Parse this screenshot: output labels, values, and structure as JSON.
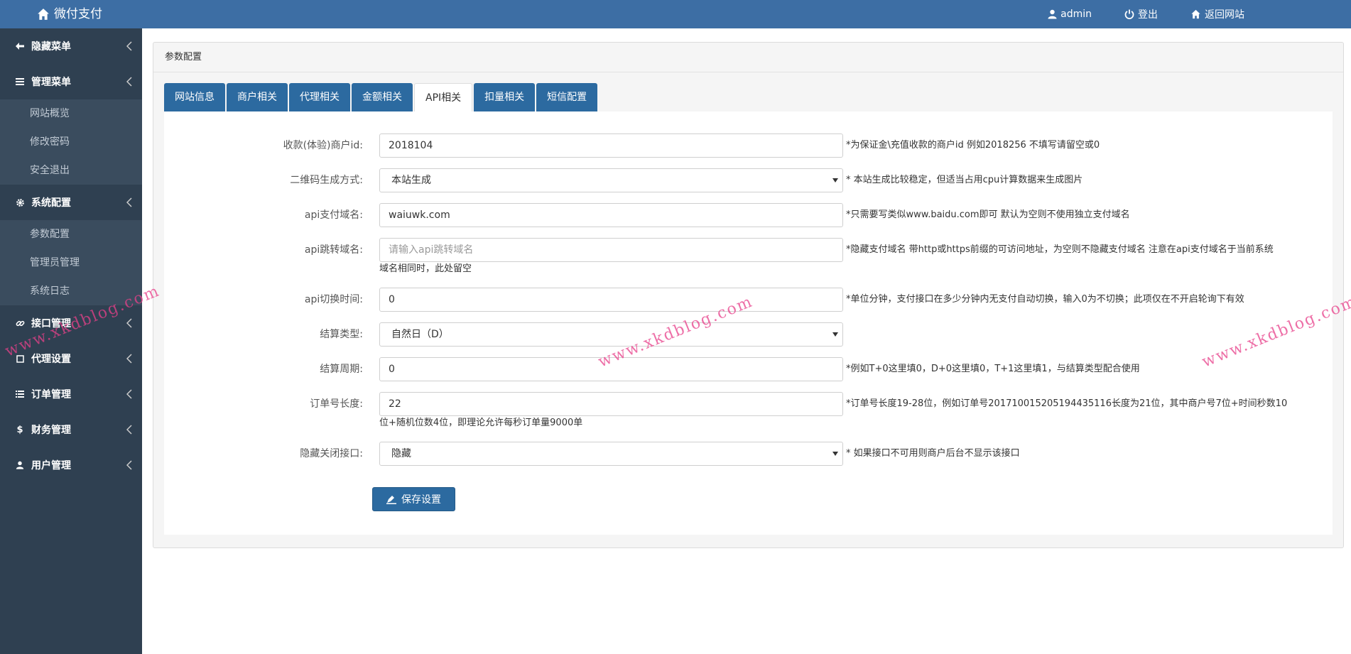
{
  "header": {
    "brand": "微付支付",
    "nav": [
      {
        "label": "admin",
        "icon": "user-icon"
      },
      {
        "label": "登出",
        "icon": "power-icon"
      },
      {
        "label": "返回网站",
        "icon": "home-icon"
      }
    ]
  },
  "sidebar": {
    "groups": [
      {
        "label": "隐藏菜单",
        "icon": "arrow-left-icon"
      },
      {
        "label": "管理菜单",
        "icon": "list-icon",
        "items": [
          "网站概览",
          "修改密码",
          "安全退出"
        ]
      },
      {
        "label": "系统配置",
        "icon": "gear-icon",
        "items": [
          "参数配置",
          "管理员管理",
          "系统日志"
        ]
      },
      {
        "label": "接口管理",
        "icon": "link-icon"
      },
      {
        "label": "代理设置",
        "icon": "square-icon"
      },
      {
        "label": "订单管理",
        "icon": "list-icon"
      },
      {
        "label": "财务管理",
        "icon": "dollar-icon"
      },
      {
        "label": "用户管理",
        "icon": "user-icon"
      }
    ]
  },
  "panel": {
    "title": "参数配置"
  },
  "tabs": [
    "网站信息",
    "商户相关",
    "代理相关",
    "金额相关",
    "API相关",
    "扣量相关",
    "短信配置"
  ],
  "active_tab": "API相关",
  "form": {
    "merchant_id": {
      "label": "收款(体验)商户id:",
      "value": "2018104",
      "hint": "*为保证金\\充值收款的商户id 例如2018256 不填写请留空或0"
    },
    "qrcode_mode": {
      "label": "二维码生成方式:",
      "value": "本站生成",
      "hint": "* 本站生成比较稳定，但适当占用cpu计算数据来生成图片"
    },
    "api_domain": {
      "label": "api支付域名:",
      "value": "waiuwk.com",
      "hint": "*只需要写类似www.baidu.com即可 默认为空则不使用独立支付域名"
    },
    "api_jump_domain": {
      "label": "api跳转域名:",
      "value": "",
      "placeholder": "请输入api跳转域名",
      "hint": "*隐藏支付域名 带http或https前缀的可访问地址，为空则不隐藏支付域名 注意在api支付域名于当前系统",
      "hint_cont": "域名相同时，此处留空"
    },
    "api_switch_time": {
      "label": "api切换时间:",
      "value": "0",
      "hint": "*单位分钟，支付接口在多少分钟内无支付自动切换，输入0为不切换；此项仅在不开启轮询下有效"
    },
    "settle_type": {
      "label": "结算类型:",
      "value": "自然日（D）"
    },
    "settle_period": {
      "label": "结算周期:",
      "value": "0",
      "hint": "*例如T+0这里填0，D+0这里填0，T+1这里填1，与结算类型配合使用"
    },
    "order_len": {
      "label": "订单号长度:",
      "value": "22",
      "hint": "*订单号长度19-28位，例如订单号20171001520519443511​6长度为21位，其中商户号7位+时间秒数10",
      "hint_cont": "位+随机位数4位，即理论允许每秒订单量9000单"
    },
    "hide_closed": {
      "label": "隐藏关闭接口:",
      "value": "隐藏",
      "hint": "* 如果接口不可用则商户后台不显示该接口"
    }
  },
  "save_label": "保存设置",
  "watermark": "www.xkdblog.com",
  "colors": {
    "topbar": "#3d6ea4",
    "sidebar": "#2f4051",
    "tab": "#2c6aa0",
    "watermark": "#e8408a"
  }
}
